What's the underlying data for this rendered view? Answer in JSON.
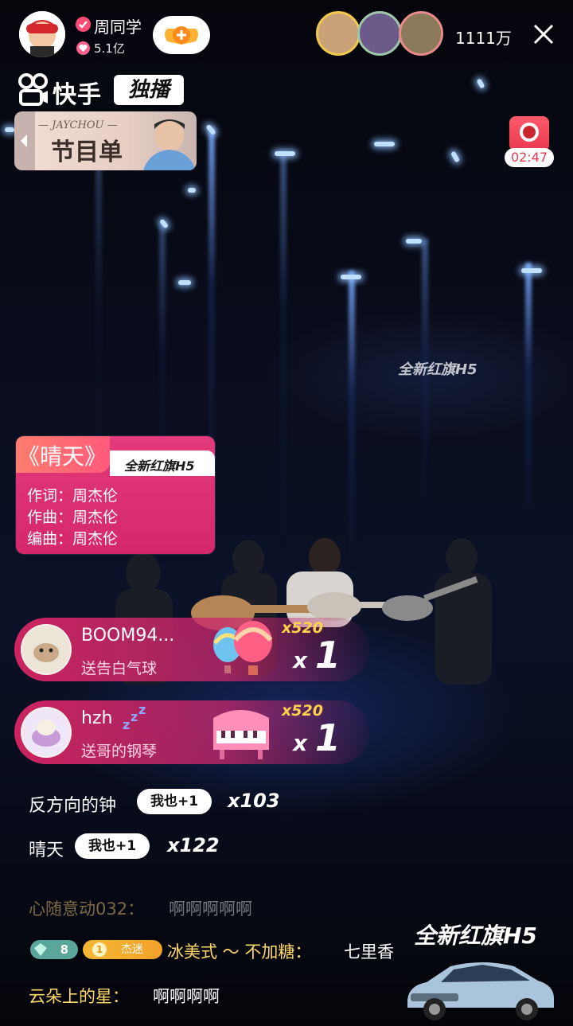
{
  "host": {
    "name": "周同学",
    "likes": "5.1亿"
  },
  "viewers": {
    "count": "1111万"
  },
  "brand": {
    "name": "快手",
    "exclusive": "独播"
  },
  "program": {
    "sub": "— JAYCHOU —",
    "title": "节目单"
  },
  "timer": {
    "value": "02:47"
  },
  "background_ad": "全新红旗H5",
  "song_card": {
    "title": "《晴天》",
    "ad": "全新红旗H5",
    "credits": [
      "作词：周杰伦",
      "作曲：周杰伦",
      "编曲：周杰伦"
    ]
  },
  "gifts": [
    {
      "user": "BOOM94...",
      "action": "送告白气球",
      "x520": "x520",
      "count": "1"
    },
    {
      "user": "hzh",
      "action": "送哥的钢琴",
      "x520": "x520",
      "count": "1"
    }
  ],
  "requests": [
    {
      "song": "反方向的钟",
      "button": "我也+1",
      "count": "x103"
    },
    {
      "song": "晴天",
      "button": "我也+1",
      "count": "x122"
    }
  ],
  "chat": [
    {
      "user": "心随意动032：",
      "text": "啊啊啊啊啊"
    },
    {
      "level": "8",
      "fan_level": "1",
      "fan_badge": "杰迷",
      "user": "冰美式 ～ 不加糖：",
      "text": "七里香"
    },
    {
      "user": "云朵上的星：",
      "text": "啊啊啊啊"
    }
  ],
  "car_ad": "全新红旗H5",
  "colors": {
    "accent": "#e23a7a",
    "gold": "#ffd24a",
    "chat_user": "#ffd86b"
  },
  "icons": [
    "verified-icon",
    "heart-icon",
    "follow-plus-icon",
    "close-icon",
    "kuaishou-logo-icon",
    "chevron-left-icon",
    "balloon-icon",
    "piano-icon",
    "snore-icon",
    "gem-icon"
  ]
}
